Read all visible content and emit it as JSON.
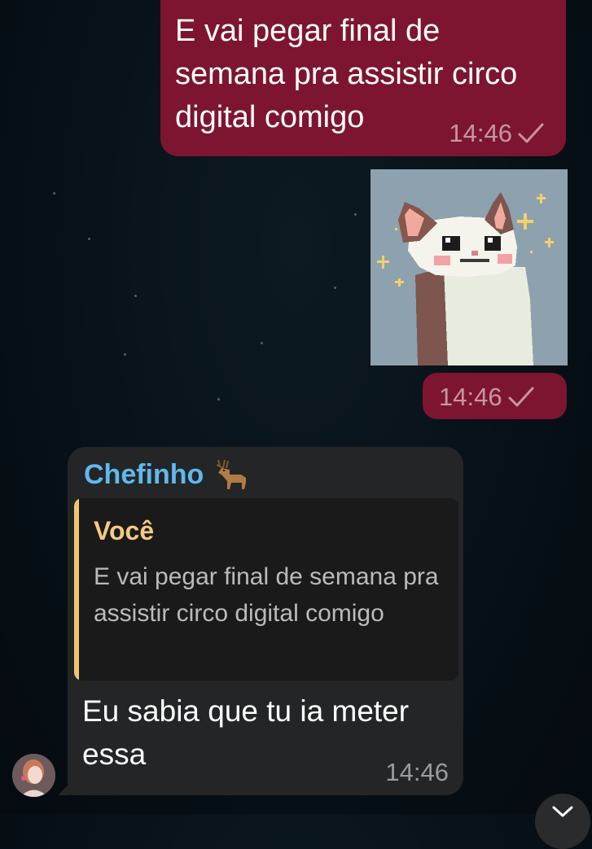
{
  "messages": {
    "outgoing_1": {
      "text": "E vai pegar final de semana pra assistir circo digital comigo",
      "time": "14:46",
      "status_icon": "single-check-icon"
    },
    "sticker": {
      "subject": "pixel-art-cat-sticker",
      "time": "14:46",
      "status_icon": "single-check-icon"
    },
    "incoming_1": {
      "sender": "Chefinho",
      "sender_emoji_icon": "deer-emoji-icon",
      "reply_to": {
        "author": "Você",
        "text": "E vai pegar final de semana pra assistir circo digital comigo"
      },
      "text": "Eu sabia que tu ia meter essa",
      "time": "14:46"
    }
  },
  "avatar": {
    "icon": "user-avatar"
  },
  "scroll_down_button": {
    "icon": "chevron-down-icon"
  },
  "colors": {
    "outgoing_bubble": "#7d1530",
    "incoming_bubble": "#242526",
    "sender_name": "#5fb9ec",
    "reply_accent": "#f0c572",
    "background": "#071017"
  }
}
